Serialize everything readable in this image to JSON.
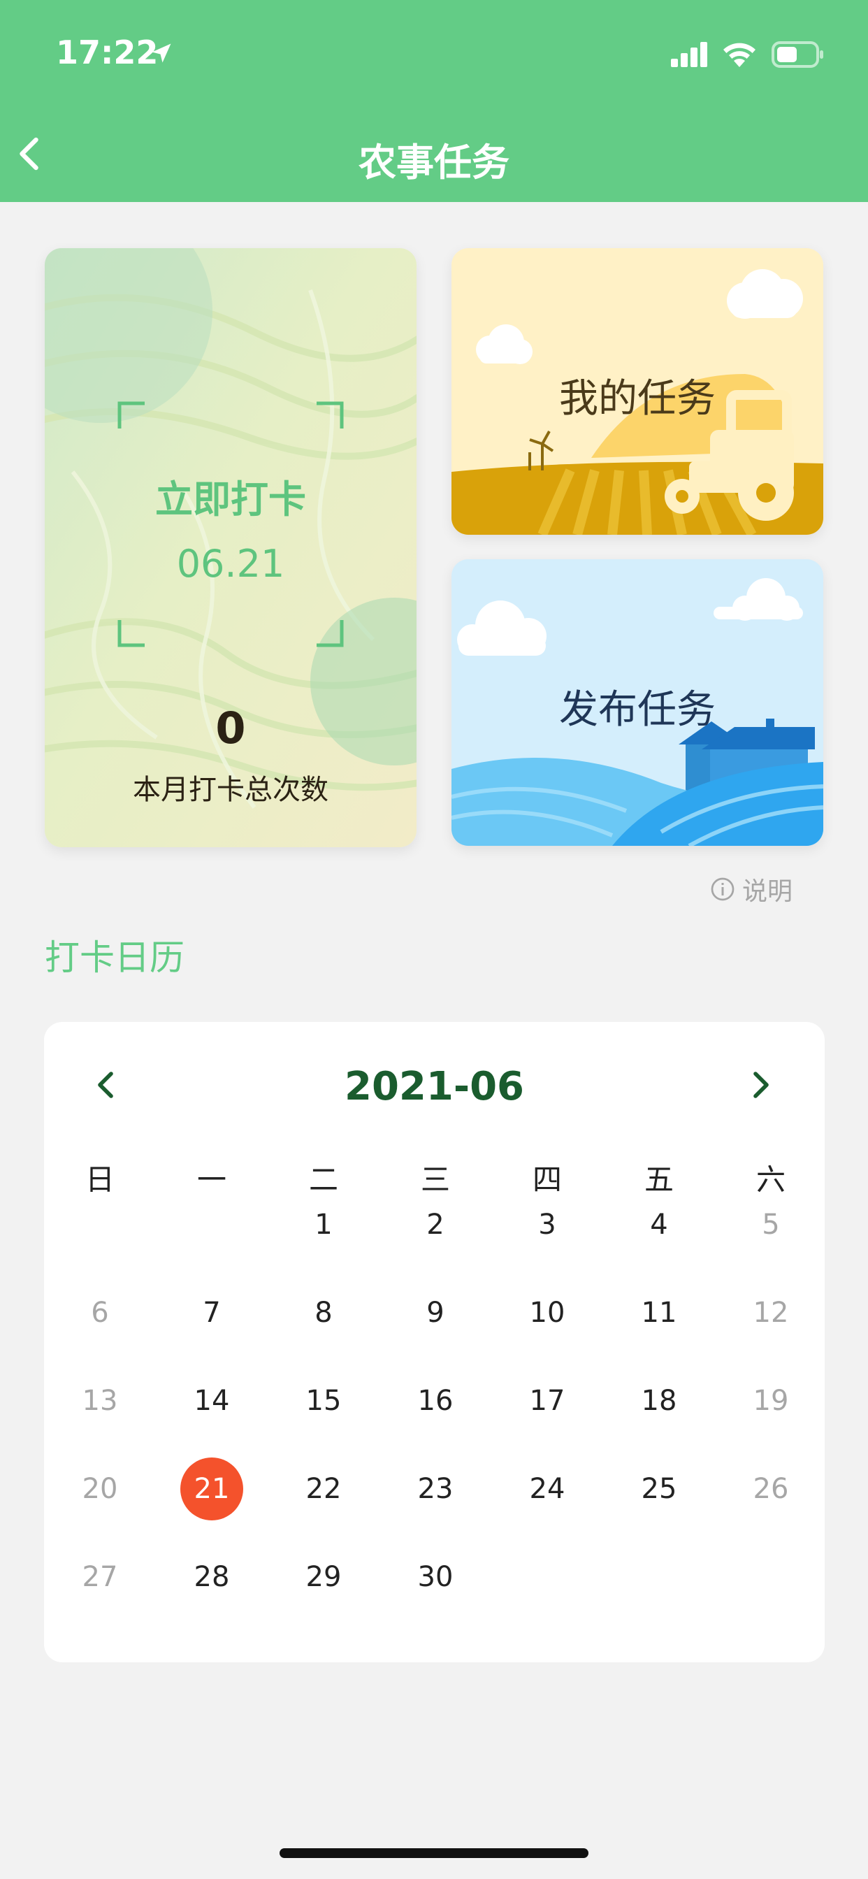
{
  "status_bar": {
    "time": "17:22"
  },
  "header": {
    "title": "农事任务"
  },
  "cards": {
    "checkin": {
      "label": "立即打卡",
      "date": "06.21",
      "count": "0",
      "count_label": "本月打卡总次数"
    },
    "my_tasks": {
      "label": "我的任务"
    },
    "publish": {
      "label": "发布任务"
    }
  },
  "info_link": {
    "label": "说明"
  },
  "section_title": "打卡日历",
  "calendar": {
    "month": "2021-06",
    "weekdays": [
      "日",
      "一",
      "二",
      "三",
      "四",
      "五",
      "六"
    ],
    "first_weekday_index": 2,
    "days": [
      "1",
      "2",
      "3",
      "4",
      "5",
      "6",
      "7",
      "8",
      "9",
      "10",
      "11",
      "12",
      "13",
      "14",
      "15",
      "16",
      "17",
      "18",
      "19",
      "20",
      "21",
      "22",
      "23",
      "24",
      "25",
      "26",
      "27",
      "28",
      "29",
      "30"
    ],
    "today": "21"
  },
  "colors": {
    "brand_green": "#63cc86",
    "month_green": "#1a5c2e",
    "today_red": "#f4522c"
  },
  "icons": {
    "back": "chevron-left-icon",
    "prev_month": "chevron-left-icon",
    "next_month": "chevron-right-icon",
    "info": "info-circle-icon",
    "location": "location-arrow-icon"
  }
}
